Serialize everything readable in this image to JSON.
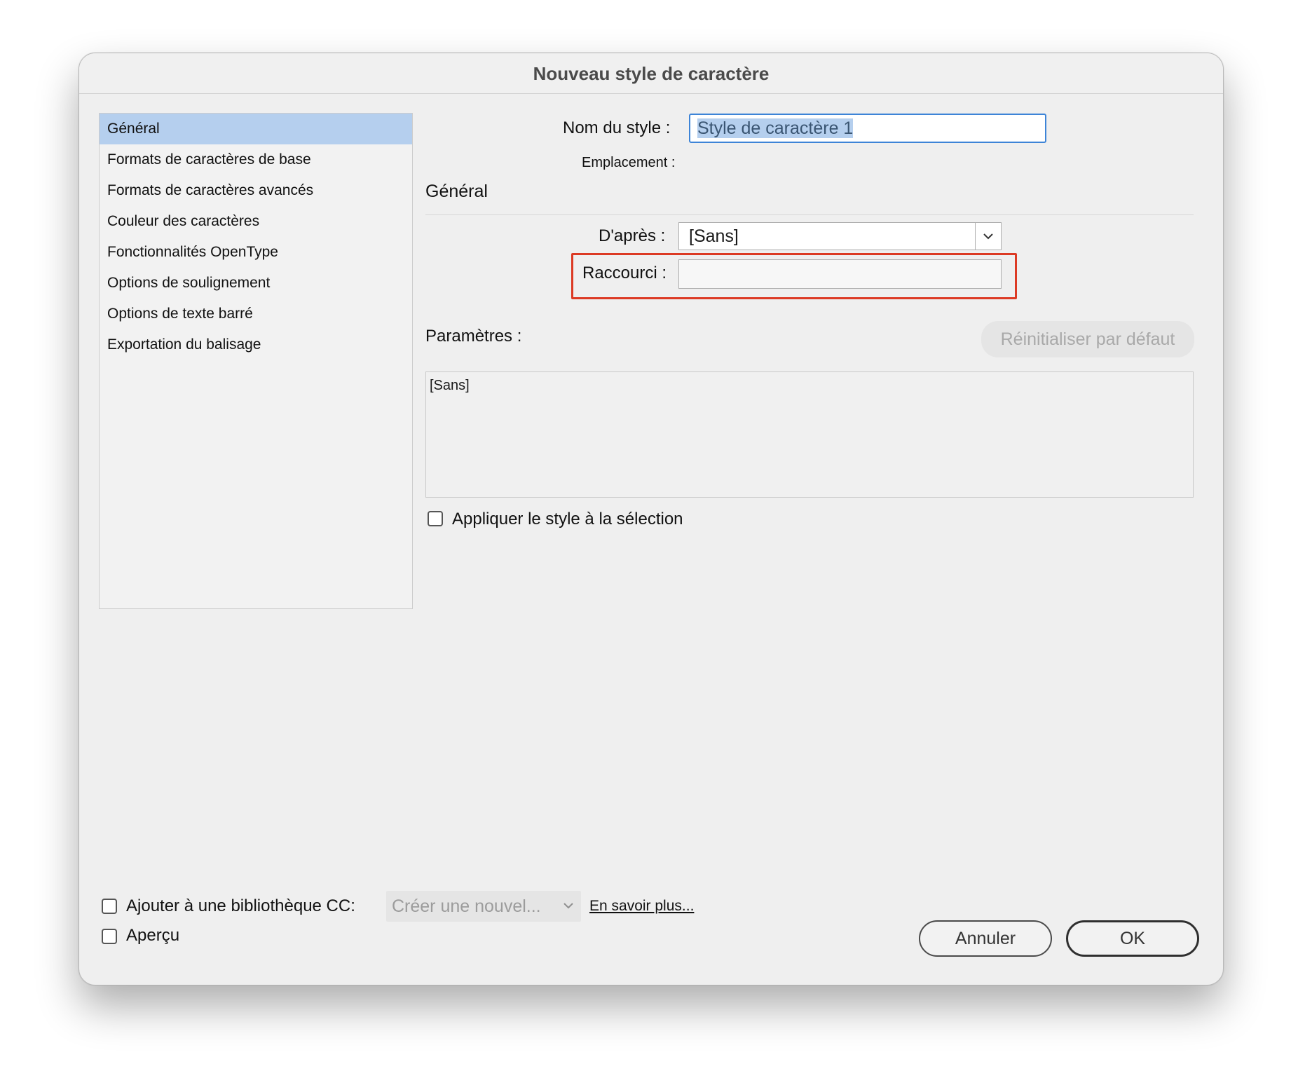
{
  "dialog": {
    "title": "Nouveau style de caractère"
  },
  "sidebar": {
    "items": [
      {
        "label": "Général",
        "selected": true
      },
      {
        "label": "Formats de caractères de base",
        "selected": false
      },
      {
        "label": "Formats de caractères avancés",
        "selected": false
      },
      {
        "label": "Couleur des caractères",
        "selected": false
      },
      {
        "label": "Fonctionnalités OpenType",
        "selected": false
      },
      {
        "label": "Options de soulignement",
        "selected": false
      },
      {
        "label": "Options de texte barré",
        "selected": false
      },
      {
        "label": "Exportation du balisage",
        "selected": false
      }
    ]
  },
  "main": {
    "style_name_label": "Nom du style :",
    "style_name_value": "Style de caractère 1",
    "location_label": "Emplacement :",
    "section_title": "Général",
    "based_on_label": "D'après :",
    "based_on_value": "[Sans]",
    "shortcut_label": "Raccourci :",
    "shortcut_value": "",
    "settings_label": "Paramètres :",
    "reset_button": "Réinitialiser par défaut",
    "settings_text": "[Sans]",
    "apply_checkbox_label": "Appliquer le style à la sélection",
    "apply_checked": false
  },
  "footer": {
    "add_cc_label": "Ajouter à une bibliothèque CC:",
    "add_cc_checked": false,
    "cc_select_value": "Créer une nouvel...",
    "learn_more": "En savoir plus...",
    "preview_label": "Aperçu",
    "preview_checked": false,
    "cancel_button": "Annuler",
    "ok_button": "OK"
  },
  "colors": {
    "selection": "#b5cfee",
    "focus_ring": "#3d84d7",
    "highlight_box": "#dc3a24"
  }
}
